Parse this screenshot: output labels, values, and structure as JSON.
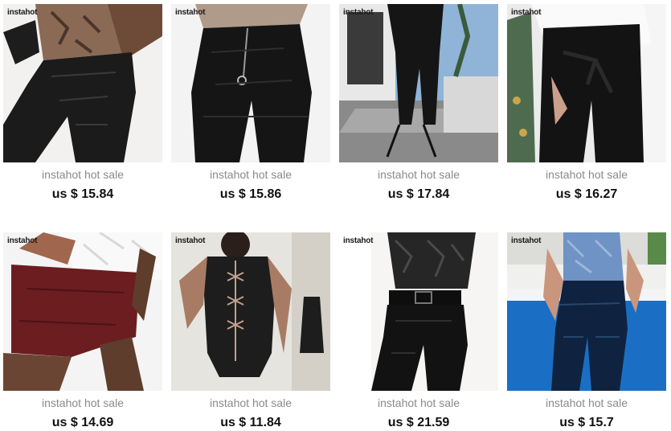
{
  "products": [
    {
      "brand": "instahot",
      "title": "instahot hot sale",
      "price": "us $ 15.84"
    },
    {
      "brand": "instahot",
      "title": "instahot hot sale",
      "price": "us $ 15.86"
    },
    {
      "brand": "instahot",
      "title": "instahot hot sale",
      "price": "us $ 17.84"
    },
    {
      "brand": "instahot",
      "title": "instahot hot sale",
      "price": "us $ 16.27"
    },
    {
      "brand": "instahot",
      "title": "instahot hot sale",
      "price": "us $ 14.69"
    },
    {
      "brand": "instahot",
      "title": "instahot hot sale",
      "price": "us $ 11.84"
    },
    {
      "brand": "instahot",
      "title": "instahot hot sale",
      "price": "us $ 21.59"
    },
    {
      "brand": "instahot",
      "title": "instahot hot sale",
      "price": "us $ 15.7"
    }
  ],
  "colors": {
    "title": "#8a8a8a",
    "price": "#111111",
    "brand_accent": "#e0203a"
  }
}
